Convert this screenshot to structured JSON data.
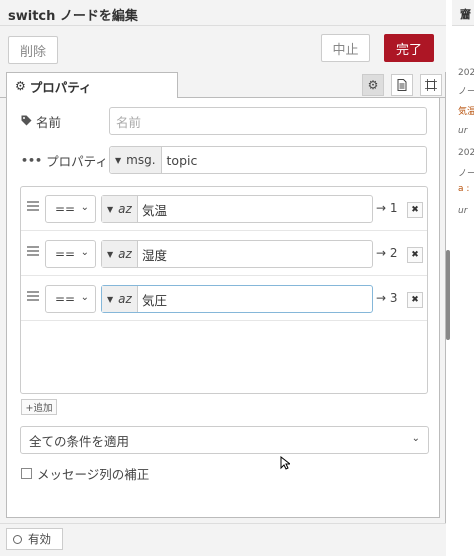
{
  "tray": {
    "title": "switch ノードを編集",
    "delete_label": "削除",
    "cancel_label": "中止",
    "done_label": "完了"
  },
  "tabs": {
    "properties_label": "プロパティ",
    "gear_icon": "gear-icon",
    "doc_icon": "document-icon",
    "frame_icon": "frame-icon"
  },
  "form": {
    "name_label": "名前",
    "name_placeholder": "名前",
    "property_label": "プロパティ",
    "property_type": "msg.",
    "property_value": "topic"
  },
  "rules": [
    {
      "op": "==",
      "type": "az",
      "value": "気温",
      "output": "→ 1"
    },
    {
      "op": "==",
      "type": "az",
      "value": "湿度",
      "output": "→ 2"
    },
    {
      "op": "==",
      "type": "az",
      "value": "気圧",
      "output": "→ 3"
    }
  ],
  "add_label": "+追加",
  "apply_mode": "全ての条件を適用",
  "recreate_label": "メッセージ列の補正",
  "footer": {
    "enabled_label": "有効"
  },
  "side_panel": {
    "header": "齏",
    "lines": [
      "202",
      "ノー",
      "気温",
      "ur",
      "202",
      "ノー",
      "a :",
      "ur"
    ]
  },
  "colors": {
    "done": "#ad1625",
    "tray_bg": "#f3f3f3"
  }
}
